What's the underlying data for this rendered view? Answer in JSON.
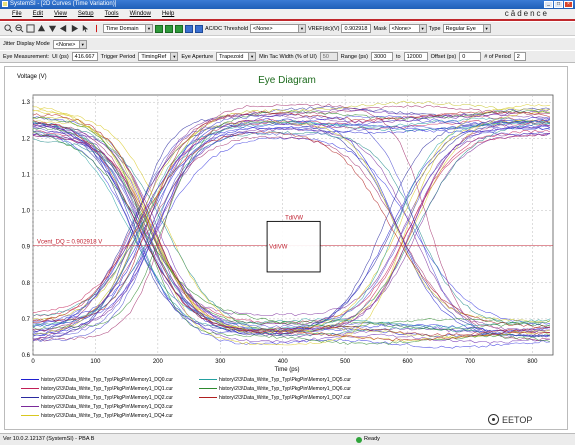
{
  "window": {
    "title": "SystemSI - [2D Curves (Time Variation)]"
  },
  "menu": [
    "File",
    "Edit",
    "View",
    "Setup",
    "Tools",
    "Window",
    "Help"
  ],
  "brand": "cādence",
  "toolbar": {
    "domain": "Time Domain",
    "threshold_label": "AC/DC Threshold",
    "threshold_value": "<None>",
    "vref_label": "VREF(dc)(V)",
    "vref_value": "0.902918",
    "mask_label": "Mask",
    "mask_value": "<None>",
    "type_label": "Type",
    "type_value": "Regular Eye"
  },
  "jitter": {
    "label": "Jitter Display Mode",
    "value": "<None>"
  },
  "measure": {
    "eye_label": "Eye Measurement:",
    "ui_label": "UI (ps)",
    "ui_value": "416.667",
    "trigger_label": "Trigger Period",
    "trigger_value": "TimingRef",
    "aperture_label": "Eye Aperture",
    "aperture_value": "Trapezoid",
    "mintac_label": "Min Tac Width (% of UI)",
    "mintac_value": "50",
    "range_label": "Range (ps)",
    "range_from": "3000",
    "range_to": "12000",
    "offset_label": "Offset (ps)",
    "offset_value": "0",
    "periods_label": "# of Period",
    "periods_value": "2"
  },
  "chart": {
    "title": "Eye Diagram",
    "ylabel": "Voltage (V)",
    "xlabel": "Time (ps)",
    "annotations": {
      "tdivw": "TdiVW",
      "vdivw": "VdiVW",
      "vcent": "Vcent_DQ = 0.902918 V"
    },
    "legend": [
      {
        "label": "history\\2\\3\\Data_Write_Typ_Typ\\PkgPin\\Memory1_DQ0.cur",
        "color": "#1f1fd0"
      },
      {
        "label": "history\\2\\3\\Data_Write_Typ_Typ\\PkgPin\\Memory1_DQ1.cur",
        "color": "#c21e56"
      },
      {
        "label": "history\\2\\3\\Data_Write_Typ_Typ\\PkgPin\\Memory1_DQ2.cur",
        "color": "#2a2aa0"
      },
      {
        "label": "history\\2\\3\\Data_Write_Typ_Typ\\PkgPin\\Memory1_DQ3.cur",
        "color": "#7a2a9a"
      },
      {
        "label": "history\\2\\3\\Data_Write_Typ_Typ\\PkgPin\\Memory1_DQ4.cur",
        "color": "#d8c820"
      },
      {
        "label": "history\\2\\3\\Data_Write_Typ_Typ\\PkgPin\\Memory1_DQ5.cur",
        "color": "#23a0a0"
      },
      {
        "label": "history\\2\\3\\Data_Write_Typ_Typ\\PkgPin\\Memory1_DQ6.cur",
        "color": "#2e8a2e"
      },
      {
        "label": "history\\2\\3\\Data_Write_Typ_Typ\\PkgPin\\Memory1_DQ7.cur",
        "color": "#b02020"
      }
    ]
  },
  "chart_data": {
    "type": "line",
    "title": "Eye Diagram",
    "xlabel": "Time (ps)",
    "ylabel": "Voltage (V)",
    "xlim": [
      0,
      833
    ],
    "ylim": [
      0.6,
      1.32
    ],
    "xticks": [
      0,
      100,
      200,
      300,
      400,
      500,
      600,
      700,
      800
    ],
    "yticks": [
      0.6,
      0.7,
      0.8,
      0.9,
      1.0,
      1.1,
      1.2,
      1.3
    ],
    "grid": true,
    "vref": 0.902918,
    "eye_mask": {
      "x": [
        375,
        460
      ],
      "y": [
        0.83,
        0.97
      ]
    },
    "series": [
      {
        "name": "Memory1_DQ0",
        "high": 1.25,
        "low": 0.66,
        "cross": 175
      },
      {
        "name": "Memory1_DQ1",
        "high": 1.24,
        "low": 0.67,
        "cross": 180
      },
      {
        "name": "Memory1_DQ2",
        "high": 1.26,
        "low": 0.65,
        "cross": 170
      },
      {
        "name": "Memory1_DQ3",
        "high": 1.23,
        "low": 0.68,
        "cross": 185
      },
      {
        "name": "Memory1_DQ4",
        "high": 1.27,
        "low": 0.64,
        "cross": 195
      },
      {
        "name": "Memory1_DQ5",
        "high": 1.22,
        "low": 0.69,
        "cross": 165
      },
      {
        "name": "Memory1_DQ6",
        "high": 1.25,
        "low": 0.66,
        "cross": 190
      },
      {
        "name": "Memory1_DQ7",
        "high": 1.24,
        "low": 0.67,
        "cross": 178
      }
    ]
  },
  "status": {
    "version": "Ver 10.0.2.12137 (SystemSI) - PBA B",
    "ready": "Ready"
  },
  "watermark": "EETOP"
}
